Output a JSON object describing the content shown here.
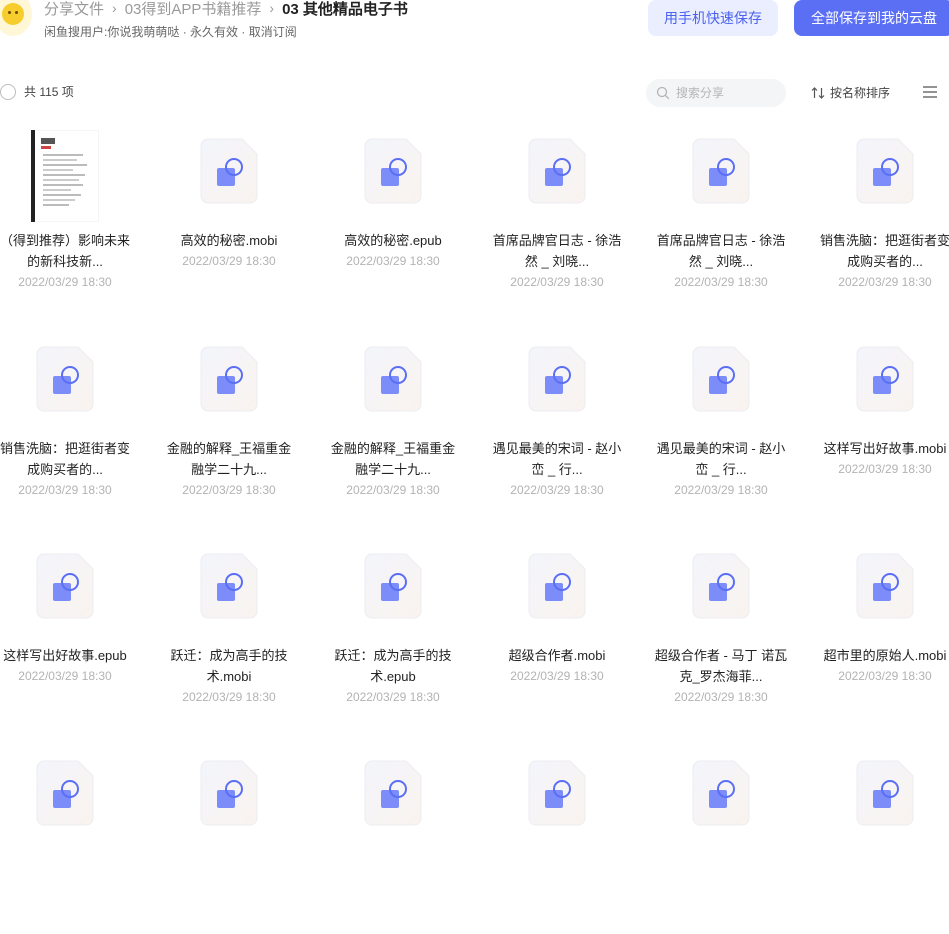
{
  "breadcrumb": {
    "items": [
      "分享文件",
      "03得到APP书籍推荐"
    ],
    "current": "03 其他精品电子书",
    "separator": "›"
  },
  "share_info": {
    "user": "闲鱼搜用户:你说我萌萌哒",
    "validity": "永久有效",
    "cancel": "取消订阅",
    "dot": "·"
  },
  "actions": {
    "phone_save": "用手机快速保存",
    "save_all": "全部保存到我的云盘"
  },
  "toolbar": {
    "count": "共 115 项",
    "search_placeholder": "搜索分享",
    "sort": "按名称排序"
  },
  "colors": {
    "accent": "#5b6ff5",
    "accent_light": "#eaeefe",
    "file_icon_bg": "#f7f4f4",
    "file_icon_square": "#7c8cf8",
    "file_icon_circle": "#5b6ff5"
  },
  "files": [
    {
      "name": "（得到推荐）影响未来的新科技新...",
      "date": "2022/03/29 18:30",
      "icon": "book-cover-thumbnail"
    },
    {
      "name": "高效的秘密.mobi",
      "date": "2022/03/29 18:30",
      "icon": "ebook-file-icon"
    },
    {
      "name": "高效的秘密.epub",
      "date": "2022/03/29 18:30",
      "icon": "ebook-file-icon"
    },
    {
      "name": "首席品牌官日志 - 徐浩然 _ 刘晓...",
      "date": "2022/03/29 18:30",
      "icon": "ebook-file-icon"
    },
    {
      "name": "首席品牌官日志 - 徐浩然 _ 刘晓...",
      "date": "2022/03/29 18:30",
      "icon": "ebook-file-icon"
    },
    {
      "name": "销售洗脑：把逛街者变成购买者的...",
      "date": "2022/03/29 18:30",
      "icon": "ebook-file-icon"
    },
    {
      "name": "销售洗脑：把逛街者变成购买者的...",
      "date": "2022/03/29 18:30",
      "icon": "ebook-file-icon"
    },
    {
      "name": "金融的解释_王福重金融学二十九...",
      "date": "2022/03/29 18:30",
      "icon": "ebook-file-icon"
    },
    {
      "name": "金融的解释_王福重金融学二十九...",
      "date": "2022/03/29 18:30",
      "icon": "ebook-file-icon"
    },
    {
      "name": "遇见最美的宋词 - 赵小峦 _ 行...",
      "date": "2022/03/29 18:30",
      "icon": "ebook-file-icon"
    },
    {
      "name": "遇见最美的宋词 - 赵小峦 _ 行...",
      "date": "2022/03/29 18:30",
      "icon": "ebook-file-icon"
    },
    {
      "name": "这样写出好故事.mobi",
      "date": "2022/03/29 18:30",
      "icon": "ebook-file-icon"
    },
    {
      "name": "这样写出好故事.epub",
      "date": "2022/03/29 18:30",
      "icon": "ebook-file-icon"
    },
    {
      "name": "跃迁：成为高手的技术.mobi",
      "date": "2022/03/29 18:30",
      "icon": "ebook-file-icon"
    },
    {
      "name": "跃迁：成为高手的技术.epub",
      "date": "2022/03/29 18:30",
      "icon": "ebook-file-icon"
    },
    {
      "name": "超级合作者.mobi",
      "date": "2022/03/29 18:30",
      "icon": "ebook-file-icon"
    },
    {
      "name": "超级合作者 - 马丁 诺瓦克_罗杰海菲...",
      "date": "2022/03/29 18:30",
      "icon": "ebook-file-icon"
    },
    {
      "name": "超市里的原始人.mobi",
      "date": "2022/03/29 18:30",
      "icon": "ebook-file-icon"
    },
    {
      "name": "",
      "date": "",
      "icon": "ebook-file-icon"
    },
    {
      "name": "",
      "date": "",
      "icon": "ebook-file-icon"
    },
    {
      "name": "",
      "date": "",
      "icon": "ebook-file-icon"
    },
    {
      "name": "",
      "date": "",
      "icon": "ebook-file-icon"
    },
    {
      "name": "",
      "date": "",
      "icon": "ebook-file-icon"
    },
    {
      "name": "",
      "date": "",
      "icon": "ebook-file-icon"
    }
  ]
}
